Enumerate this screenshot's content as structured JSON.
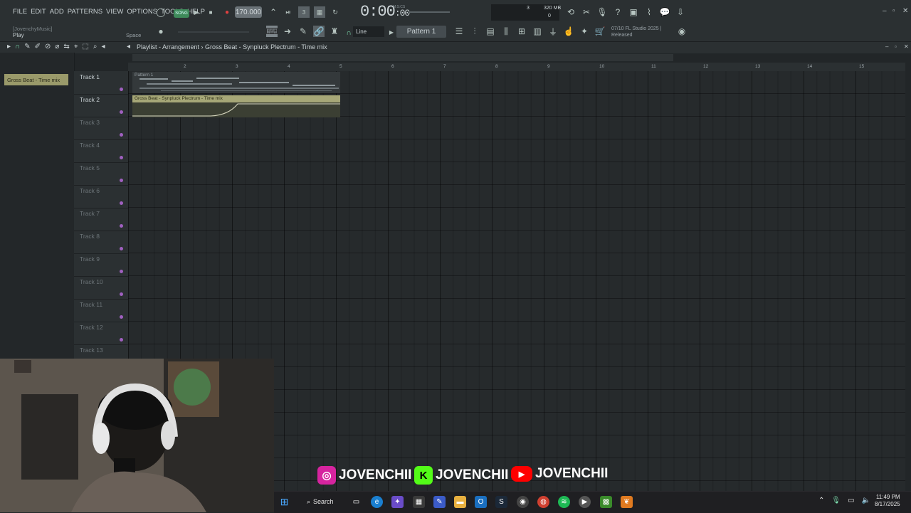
{
  "menu": [
    "FILE",
    "EDIT",
    "ADD",
    "PATTERNS",
    "VIEW",
    "OPTIONS",
    "TOOLS",
    "HELP"
  ],
  "hint": {
    "project": "[JovenchyMusic]",
    "action": "Play",
    "key": "Space"
  },
  "transport": {
    "mode_label": "SONG",
    "bpm": "170.000",
    "time": "0:00",
    "time_frac": ":00",
    "mcs_label": "M:S:CS"
  },
  "monitor": {
    "num": "3",
    "memory": "320 MB",
    "zero": "0"
  },
  "info": {
    "line1": "07/10  FL Studio 2025 |",
    "line2": "Released"
  },
  "snap": "Line",
  "pattern_selector": "Pattern 1",
  "playlist": {
    "title": "Playlist - Arrangement",
    "clip_name": "Gross Beat - Synpluck Plectrum - Time mix",
    "ruler_ticks": [
      "2",
      "3",
      "4",
      "5",
      "6",
      "7",
      "8",
      "9",
      "10",
      "11",
      "12",
      "13",
      "14",
      "15"
    ],
    "tracks": [
      "Track 1",
      "Track 2",
      "Track 3",
      "Track 4",
      "Track 5",
      "Track 6",
      "Track 7",
      "Track 8",
      "Track 9",
      "Track 10",
      "Track 11",
      "Track 12",
      "Track 13"
    ],
    "pattern_clip": "Pattern 1",
    "automation_clip": "Gross Beat - Synpluck Plectrum - Time mix"
  },
  "browser": {
    "item": "Gross Beat - Time mix"
  },
  "socials": [
    {
      "platform": "instagram",
      "handle": "JOVENCHII",
      "color": "#d6249f"
    },
    {
      "platform": "kick",
      "handle": "JOVENCHII",
      "color": "#53fc18"
    },
    {
      "platform": "youtube",
      "handle": "JOVENCHII",
      "color": "#ff0000"
    }
  ],
  "taskbar": {
    "search": "Search",
    "time": "11:49 PM",
    "date": "8/17/2025"
  },
  "colors": {
    "accent": "#7ee0b0",
    "clip": "#a6a777",
    "record": "#e04040"
  }
}
